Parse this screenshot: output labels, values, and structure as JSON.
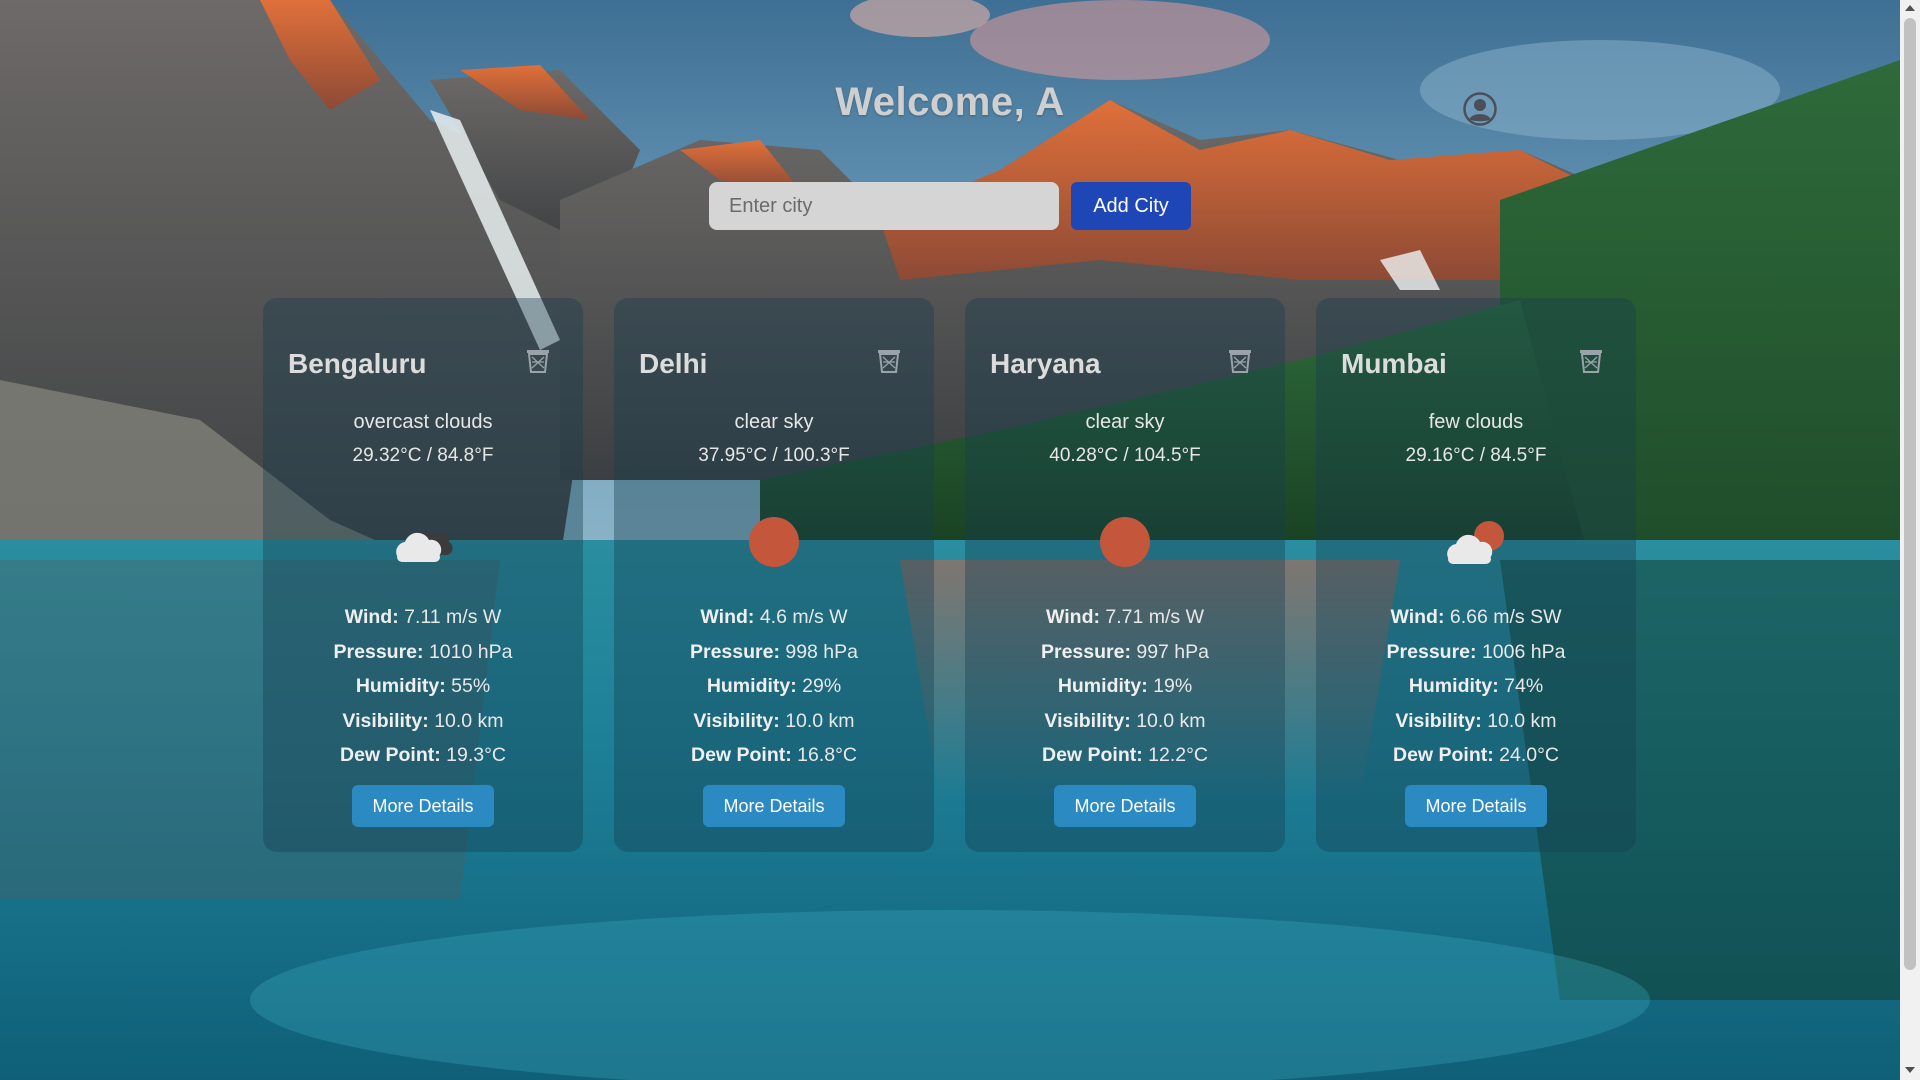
{
  "header": {
    "title": "Welcome, A",
    "profile_icon": "user-circle-icon"
  },
  "search": {
    "placeholder": "Enter city",
    "value": "",
    "add_button_label": "Add City"
  },
  "labels": {
    "wind": "Wind:",
    "pressure": "Pressure:",
    "humidity": "Humidity:",
    "visibility": "Visibility:",
    "dew_point": "Dew Point:",
    "more_details": "More Details"
  },
  "cards": [
    {
      "city": "Bengaluru",
      "description": "overcast clouds",
      "temperature": "29.32°C / 84.8°F",
      "icon": "overcast-clouds-icon",
      "wind": "7.11 m/s W",
      "pressure": "1010 hPa",
      "humidity": "55%",
      "visibility": "10.0 km",
      "dew_point": "19.3°C"
    },
    {
      "city": "Delhi",
      "description": "clear sky",
      "temperature": "37.95°C / 100.3°F",
      "icon": "sun-icon",
      "wind": "4.6 m/s W",
      "pressure": "998 hPa",
      "humidity": "29%",
      "visibility": "10.0 km",
      "dew_point": "16.8°C"
    },
    {
      "city": "Haryana",
      "description": "clear sky",
      "temperature": "40.28°C / 104.5°F",
      "icon": "sun-icon",
      "wind": "7.71 m/s W",
      "pressure": "997 hPa",
      "humidity": "19%",
      "visibility": "10.0 km",
      "dew_point": "12.2°C"
    },
    {
      "city": "Mumbai",
      "description": "few clouds",
      "temperature": "29.16°C / 84.5°F",
      "icon": "few-clouds-icon",
      "wind": "6.66 m/s SW",
      "pressure": "1006 hPa",
      "humidity": "74%",
      "visibility": "10.0 km",
      "dew_point": "24.0°C"
    }
  ],
  "colors": {
    "add_button": "#1e46b7",
    "more_details_button": "#2c8ac2",
    "sun": "#c4563c",
    "title": "#cfcfcf"
  }
}
